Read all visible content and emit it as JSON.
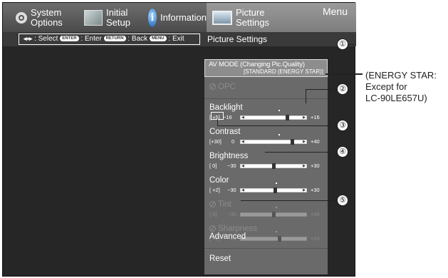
{
  "tabs": [
    {
      "label": "System\nOptions",
      "icon": "gear-icon"
    },
    {
      "label": "Initial\nSetup",
      "icon": "setup-icon"
    },
    {
      "label": "Information",
      "icon": "info-icon"
    },
    {
      "label": "Picture\nSettings",
      "icon": "picture-icon"
    }
  ],
  "menu_label": "Menu",
  "help": {
    "select": ": Select",
    "enter_key": "ENTER",
    "enter": ": Enter",
    "return_key": "RETURN",
    "back": ": Back",
    "menu_key": "MENU",
    "exit": ": Exit"
  },
  "section_title": "Picture Settings",
  "av_mode": {
    "title": "AV MODE (Changing Pic.Quality)",
    "value": "[STANDARD (ENERGY STAR)]"
  },
  "items": {
    "opc": {
      "label": "OPC"
    },
    "backlight": {
      "label": "Backlight",
      "value": "[ +5]",
      "min": "−16",
      "max": "+16",
      "level": 5
    },
    "contrast": {
      "label": "Contrast",
      "value": "[+30]",
      "min": "0",
      "max": "+40",
      "level": 30
    },
    "brightness": {
      "label": "Brightness",
      "value": "[  0]",
      "min": "−30",
      "max": "+30",
      "level": 0
    },
    "color": {
      "label": "Color",
      "value": "[ +2]",
      "min": "−30",
      "max": "+30",
      "level": 2
    },
    "tint": {
      "label": "Tint",
      "value": "[  0]",
      "min": "−30",
      "max": "+30",
      "level": 0
    },
    "sharpness": {
      "label": "Sharpness",
      "value": "[ +2]",
      "min": "−10",
      "max": "+10",
      "level": 2
    },
    "advanced": {
      "label": "Advanced"
    },
    "reset": {
      "label": "Reset"
    }
  },
  "callouts": [
    "①",
    "②",
    "③",
    "④",
    "⑤"
  ],
  "note": {
    "line1": "(ENERGY STAR:",
    "line2": "Except for",
    "line3": "LC-90LE657U)"
  }
}
